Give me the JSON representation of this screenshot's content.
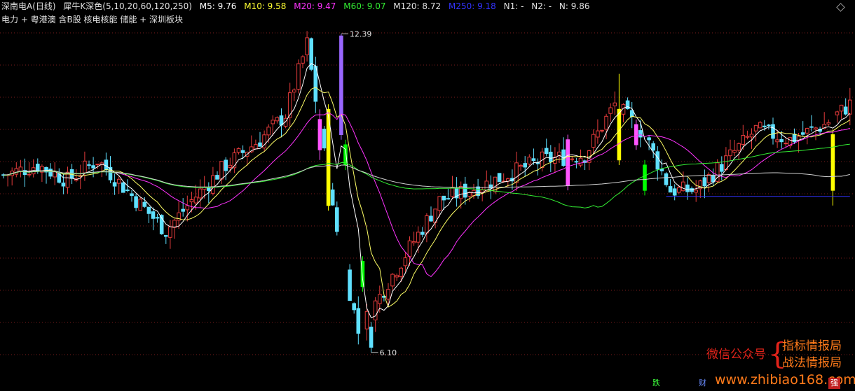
{
  "header": {
    "stock": "深南电A(日线)",
    "indicator": "犀牛K深色(5,10,20,60,120,250)",
    "ma": [
      {
        "label": "M5: 9.76",
        "color": "#ffffff"
      },
      {
        "label": "M10: 9.58",
        "color": "#ffff33"
      },
      {
        "label": "M20: 9.47",
        "color": "#ff33ff"
      },
      {
        "label": "M60: 9.07",
        "color": "#33ee33"
      },
      {
        "label": "M120: 8.72",
        "color": "#e0e0e0"
      },
      {
        "label": "M250: 9.18",
        "color": "#3333ff"
      },
      {
        "label": "N1: -",
        "color": "#e0e0e0"
      },
      {
        "label": "N2: -",
        "color": "#e0e0e0"
      },
      {
        "label": "N: 9.86",
        "color": "#e0e0e0"
      }
    ]
  },
  "tags": "电力 + 粤港澳 含B股 核电核能 储能 + 深圳板块",
  "watermark": {
    "line_a": "微信公众号",
    "line_b": "指标情报局",
    "line_c": "战法情报局",
    "url": "www.zhibiao168.com",
    "brace": "{"
  },
  "badges": {
    "die": "跌",
    "cai": "财",
    "qiang": "强"
  },
  "chart_data": {
    "type": "candlestick",
    "price_range": [
      5.6,
      12.7
    ],
    "annotations": [
      {
        "text": "12.39",
        "kind": "high"
      },
      {
        "text": "6.10",
        "kind": "low"
      }
    ],
    "colors": {
      "up": "#e43b3b",
      "down": "#5fe0ff",
      "grid": "#7a1c1c",
      "strong_up": "#ffff00",
      "strong_down": "#00ff00",
      "pink": "#ff55ff",
      "purple": "#9966ff",
      "ma5": "#ffffff",
      "ma10": "#ffff66",
      "ma20": "#ff33ff",
      "ma60": "#33ee33",
      "ma120": "#d0d0d0",
      "ma250": "#3333ff"
    }
  }
}
